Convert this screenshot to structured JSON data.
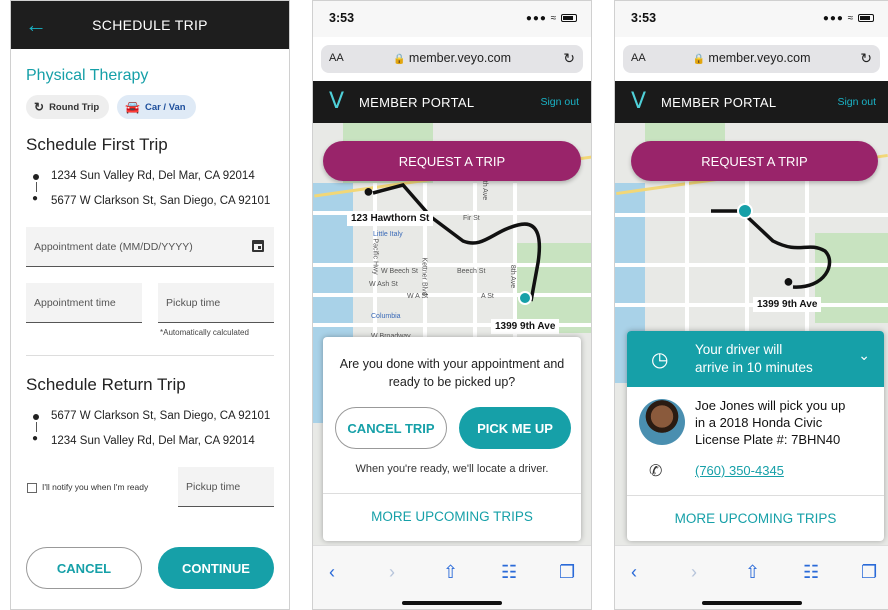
{
  "screen1": {
    "header_title": "SCHEDULE TRIP",
    "back_icon": "arrow-left-icon",
    "subtitle": "Physical Therapy",
    "chips": {
      "round_trip": "Round Trip",
      "car_van": "Car / Van"
    },
    "first_trip": {
      "title": "Schedule First Trip",
      "from": "1234 Sun Valley Rd, Del Mar, CA 92014",
      "to": "5677 W Clarkson St, San Diego, CA 92101"
    },
    "appointment_date_placeholder": "Appointment date (MM/DD/YYYY)",
    "appointment_time_placeholder": "Appointment time",
    "pickup_time_placeholder": "Pickup time",
    "auto_note": "*Automatically calculated",
    "return_trip": {
      "title": "Schedule Return Trip",
      "from": "5677 W Clarkson St, San Diego, CA 92101",
      "to": "1234 Sun Valley Rd, Del Mar, CA 92014"
    },
    "notify_label": "I'll notify you when I'm ready",
    "return_pickup_placeholder": "Pickup time",
    "cancel": "CANCEL",
    "continue": "CONTINUE",
    "accent_color": "#16a0a8"
  },
  "phone": {
    "time": "3:53",
    "aa": "AA",
    "url": "member.veyo.com",
    "portal_title": "MEMBER PORTAL",
    "sign_out": "Sign out",
    "request_trip": "REQUEST A TRIP",
    "request_color": "#99246a"
  },
  "screen2": {
    "origin_label": "123 Hawthorn St",
    "dest_label": "1399 9th Ave",
    "question": "Are you done with your appointment and ready to be picked up?",
    "cancel_trip": "CANCEL TRIP",
    "pick_me_up": "PICK ME UP",
    "tip": "When you're ready, we'll locate a driver.",
    "more_trips": "MORE UPCOMING TRIPS",
    "streets": [
      "Little Italy",
      "W Beech St",
      "Beech St",
      "W Ash St",
      "W A St",
      "A St",
      "Columbia",
      "W Broadway",
      "Fir St",
      "Pacific Hwy",
      "Kettner Blvd",
      "5th Ave",
      "8th Ave"
    ]
  },
  "screen3": {
    "dest_label": "1399 9th Ave",
    "driver_msg_1": "Your driver will",
    "driver_msg_2": "arrive in 10 minutes",
    "driver_line_1": "Joe Jones will pick you up",
    "driver_line_2": "in a 2018 Honda Civic",
    "driver_line_3": "License Plate #: 7BHN40",
    "phone_number": "(760) 350-4345",
    "more_trips": "MORE UPCOMING TRIPS"
  }
}
